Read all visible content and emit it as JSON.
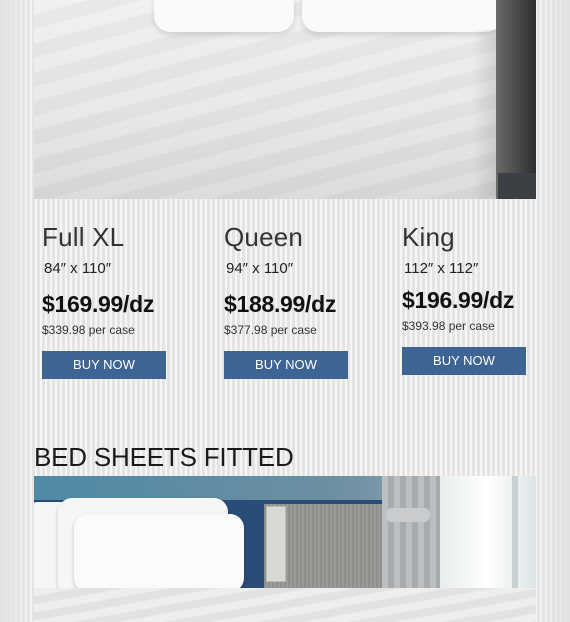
{
  "products": [
    {
      "name": "Full XL",
      "size": "84″ x 110″",
      "price": "$169.99/dz",
      "case_price": "$339.98 per case",
      "button_label": "BUY NOW"
    },
    {
      "name": "Queen",
      "size": "94″ x 110″",
      "price": "$188.99/dz",
      "case_price": "$377.98 per case",
      "button_label": "BUY NOW"
    },
    {
      "name": "King",
      "size": "112″ x 112″",
      "price": "$196.99/dz",
      "case_price": "$393.98 per case",
      "button_label": "BUY NOW"
    }
  ],
  "section_title": "BED SHEETS FITTED",
  "colors": {
    "button": "#3e6494",
    "text": "#111111",
    "background": "#eceae8"
  }
}
